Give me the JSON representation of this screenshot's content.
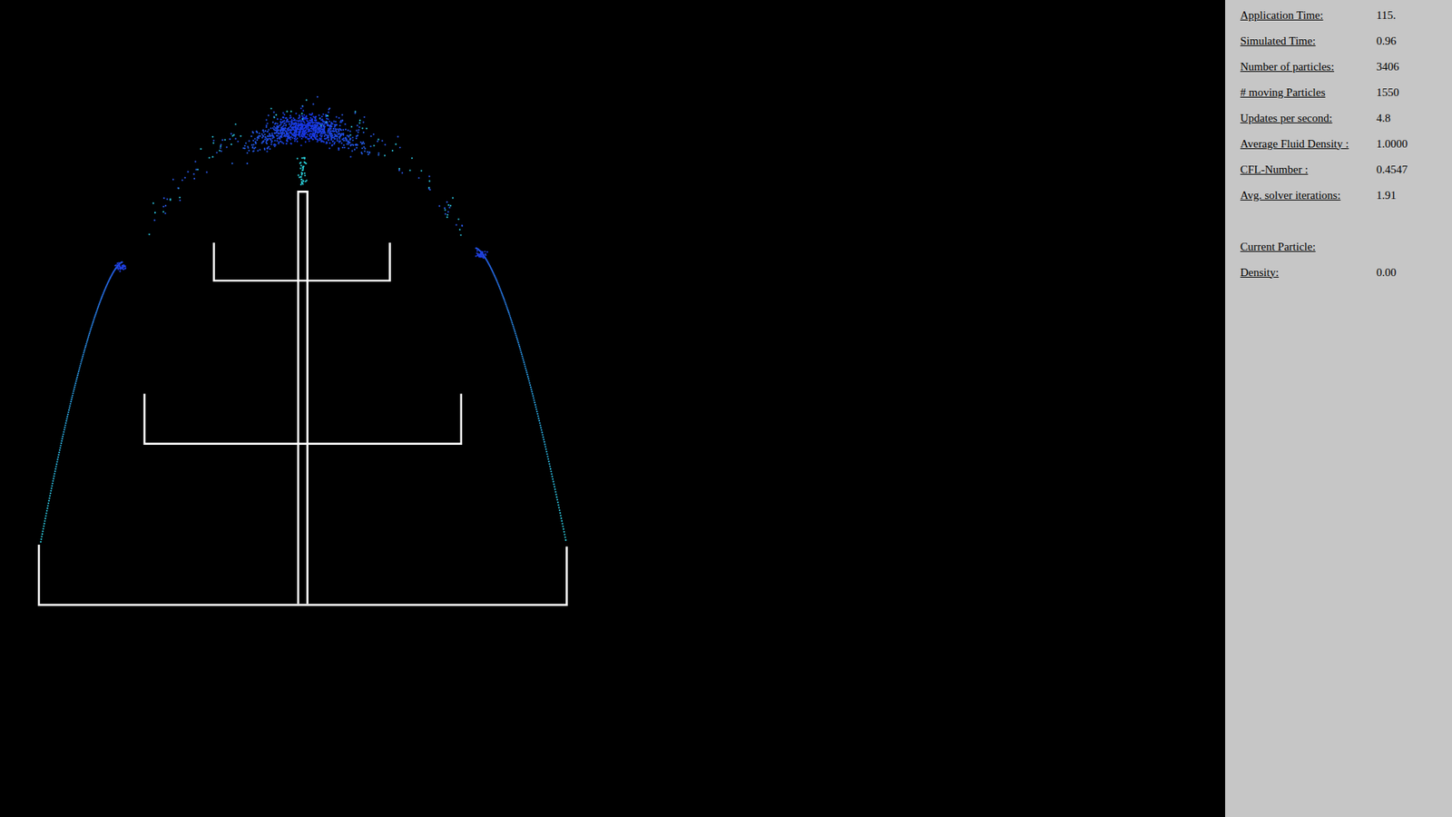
{
  "stats": [
    {
      "label": "Application Time:",
      "value": "115."
    },
    {
      "label": "Simulated Time:",
      "value": "0.96"
    },
    {
      "label": "Number of particles:",
      "value": "3406"
    },
    {
      "label": "# moving Particles",
      "value": "1550"
    },
    {
      "label": "Updates per second:",
      "value": "4.8"
    },
    {
      "label": "Average Fluid Density :",
      "value": "1.0000"
    },
    {
      "label": "CFL-Number :",
      "value": "0.4547"
    },
    {
      "label": "Avg. solver iterations:",
      "value": "1.91"
    }
  ],
  "current_particle": {
    "label": "Current Particle:"
  },
  "particle_stats": [
    {
      "label": "Density:",
      "value": "0.00"
    }
  ]
}
